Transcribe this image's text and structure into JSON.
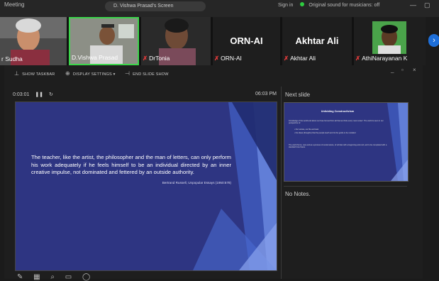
{
  "topbar": {
    "left_text": "Meeting",
    "center_text": "D. Vishwa Prasad's Screen",
    "right_text": "Sign in",
    "status_text": "Original sound for musicians: off",
    "min_icon": "minimize-icon",
    "max_icon": "maximize-icon"
  },
  "gallery": {
    "participants": [
      {
        "name": "r Sudha",
        "muted": false
      },
      {
        "name": "D.Vishwa Prasad",
        "muted": false
      },
      {
        "name": "DrTonia",
        "muted": true
      },
      {
        "name": "ORN-AI",
        "muted": true,
        "display": "ORN-AI"
      },
      {
        "name": "Akhtar Ali",
        "muted": true,
        "display": "Akhtar Ali"
      },
      {
        "name": "AthiNarayanan K",
        "muted": true
      }
    ],
    "next_page_icon": "chevron-right-icon"
  },
  "presenter_toolbar": {
    "show_taskbar": "SHOW TASKBAR",
    "display_settings": "DISPLAY SETTINGS ▾",
    "end_slide_show": "END SLIDE SHOW",
    "window_min": "_",
    "window_max": "▫",
    "window_close": "×"
  },
  "presenter": {
    "timer": "0:03:01",
    "pause_icon": "pause-icon",
    "reset_icon": "reset-icon",
    "clock": "06:03 PM",
    "next_slide_label": "Next slide",
    "notes": "No Notes."
  },
  "current_slide": {
    "quote": "The teacher, like the artist, the philosopher and the man of letters, can only perform his work adequately if he feels himself to be an individual directed by an inner creative impulse, not dominated and fettered by an outside authority.",
    "attribution": "Bertrand Russell, Unpopular Essays (1950:578)"
  },
  "next_slide": {
    "title": "Unfolding Constructivism",
    "lines": [
      "Knowledge of the world and about our lives formed from all that we think every 'new review'. The world is seen in our perspective of:",
      "• Our stories, our life and task",
      "• the ideas (thoughts) that the people teach and its the guide to be modeled",
      "The world forms, new and as a process of social nature, of scholar with a beginning and end, and to be completed with a standard time frame."
    ]
  },
  "bottom_tools": [
    "pen-icon",
    "eraser-icon",
    "search-icon",
    "screen-icon",
    "subtitles-icon"
  ]
}
